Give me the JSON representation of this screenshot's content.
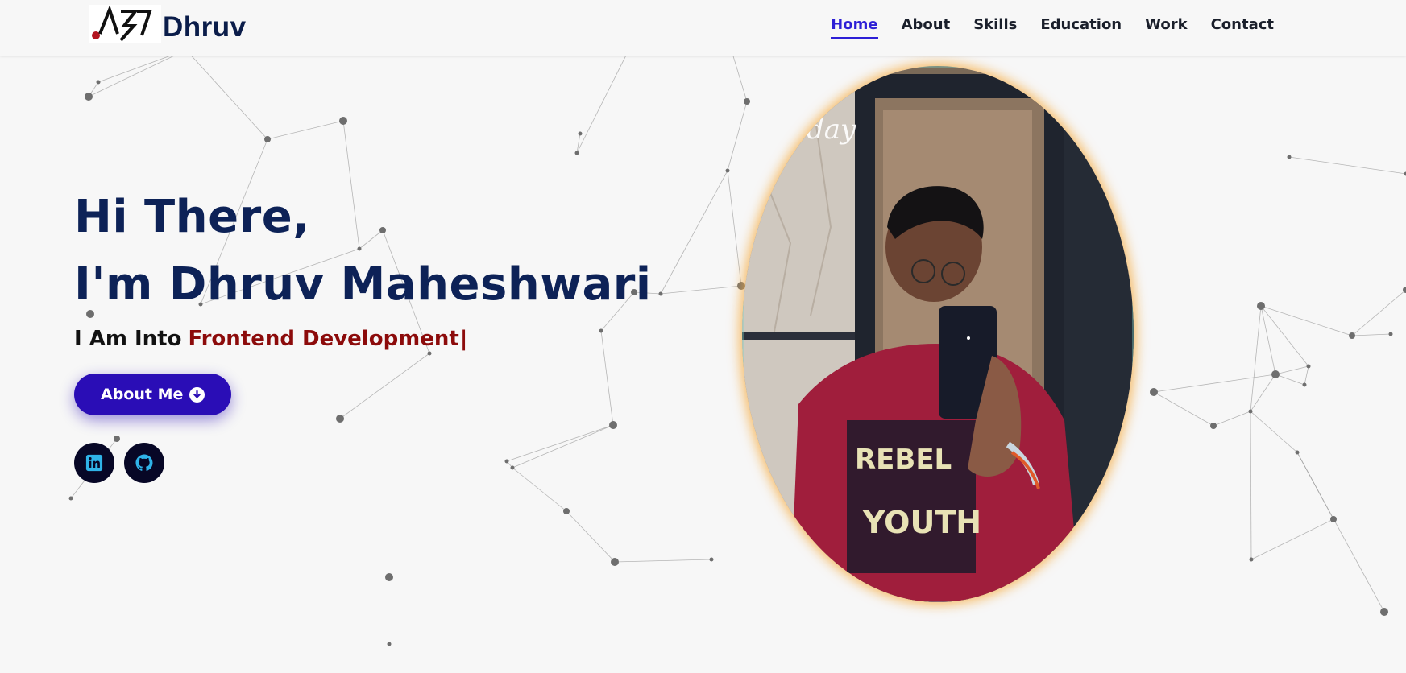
{
  "header": {
    "logo_text": "Dhruv",
    "nav": [
      "Home",
      "About",
      "Skills",
      "Education",
      "Work",
      "Contact"
    ],
    "active_nav": "Home"
  },
  "hero": {
    "greeting_line1": "Hi There,",
    "greeting_line2": "I'm Dhruv Maheshwari",
    "tagline_prefix": "I Am Into",
    "tagline_role": "Frontend Development",
    "tagline_caret": "|",
    "cta_label": "About Me",
    "cta_icon": "arrow-down-circle-icon"
  },
  "socials": [
    {
      "name": "linkedin-icon",
      "color": "#2fb3e8"
    },
    {
      "name": "github-icon",
      "color": "#2fb3e8"
    }
  ],
  "photo": {
    "description_icon": "profile-photo",
    "shirt_text": "REBEL YOUTH"
  },
  "colors": {
    "background": "#f7f7f7",
    "heading": "#0d2257",
    "accent_role": "#8c0b0b",
    "button": "#2a0db6",
    "nav_active": "#2d1fd6",
    "photo_glow": "#f6aa3c"
  }
}
